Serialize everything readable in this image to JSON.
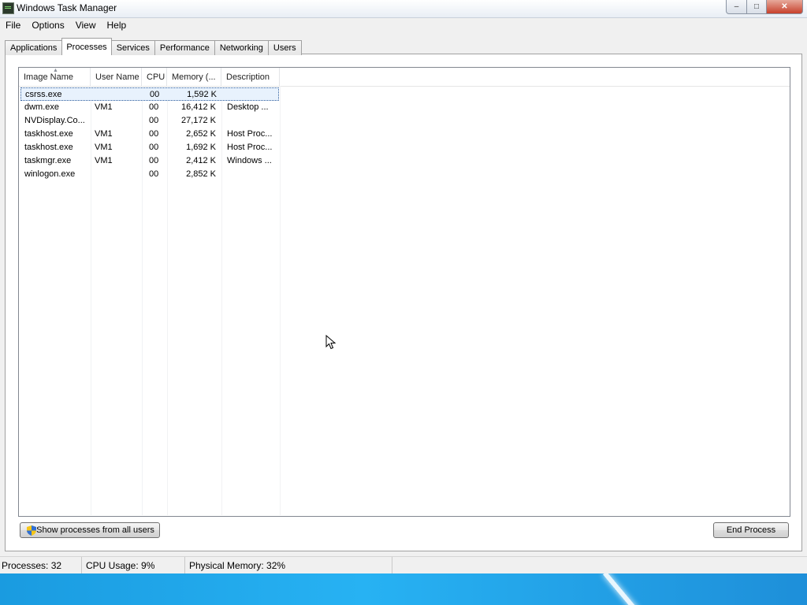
{
  "window": {
    "title": "Windows Task Manager",
    "controls": {
      "minimize": "–",
      "maximize": "□",
      "close": "✕"
    }
  },
  "menu": [
    "File",
    "Options",
    "View",
    "Help"
  ],
  "tabs": [
    "Applications",
    "Processes",
    "Services",
    "Performance",
    "Networking",
    "Users"
  ],
  "active_tab": "Processes",
  "columns": [
    "Image Name",
    "User Name",
    "CPU",
    "Memory (...",
    "Description"
  ],
  "sorted_column": "Image Name",
  "processes": [
    {
      "name": "csrss.exe",
      "user": "",
      "cpu": "00",
      "memory": "1,592 K",
      "description": "",
      "selected": true
    },
    {
      "name": "dwm.exe",
      "user": "VM1",
      "cpu": "00",
      "memory": "16,412 K",
      "description": "Desktop ..."
    },
    {
      "name": "NVDisplay.Co...",
      "user": "",
      "cpu": "00",
      "memory": "27,172 K",
      "description": ""
    },
    {
      "name": "taskhost.exe",
      "user": "VM1",
      "cpu": "00",
      "memory": "2,652 K",
      "description": "Host Proc..."
    },
    {
      "name": "taskhost.exe",
      "user": "VM1",
      "cpu": "00",
      "memory": "1,692 K",
      "description": "Host Proc..."
    },
    {
      "name": "taskmgr.exe",
      "user": "VM1",
      "cpu": "00",
      "memory": "2,412 K",
      "description": "Windows ..."
    },
    {
      "name": "winlogon.exe",
      "user": "",
      "cpu": "00",
      "memory": "2,852 K",
      "description": ""
    }
  ],
  "buttons": {
    "show_all": "Show processes from all users",
    "end_process": "End Process"
  },
  "status": {
    "processes": "Processes: 32",
    "cpu": "CPU Usage: 9%",
    "memory": "Physical Memory: 32%"
  },
  "colors": {
    "selection": "#e8f2fd",
    "desktop": "#1e9fe8",
    "close_button": "#c7412c"
  }
}
